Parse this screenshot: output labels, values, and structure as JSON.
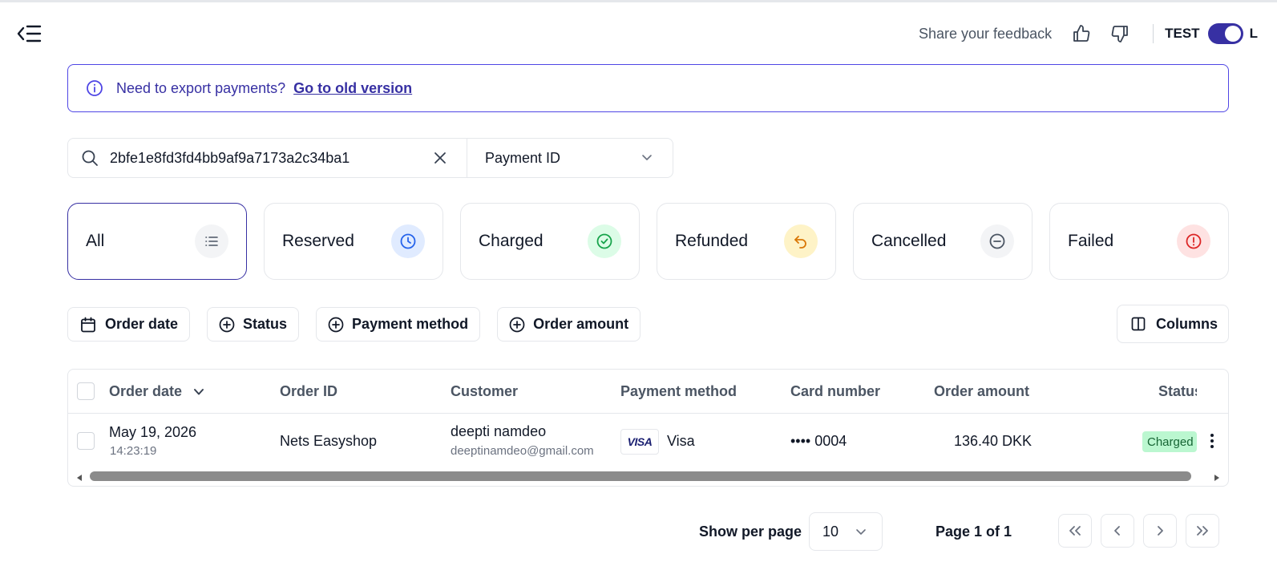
{
  "header": {
    "feedback_label": "Share your feedback",
    "mode_test_label": "TEST",
    "mode_live_label": "L"
  },
  "banner": {
    "text": "Need to export payments?",
    "link_label": "Go to old version"
  },
  "search": {
    "value": "2bfe1e8fd3fd4bb9af9a7173a2c34ba1",
    "type_selected": "Payment ID"
  },
  "status_cards": [
    {
      "label": "All",
      "icon": "list-icon",
      "active": true
    },
    {
      "label": "Reserved",
      "icon": "clock-icon"
    },
    {
      "label": "Charged",
      "icon": "check-circle-icon"
    },
    {
      "label": "Refunded",
      "icon": "undo-arrow-icon"
    },
    {
      "label": "Cancelled",
      "icon": "minus-circle-icon"
    },
    {
      "label": "Failed",
      "icon": "alert-circle-icon"
    }
  ],
  "filters": {
    "order_date": "Order date",
    "status": "Status",
    "payment_method": "Payment method",
    "order_amount": "Order amount",
    "columns": "Columns"
  },
  "table": {
    "headers": {
      "order_date": "Order date",
      "order_id": "Order ID",
      "customer": "Customer",
      "payment_method": "Payment method",
      "card_number": "Card number",
      "order_amount": "Order amount",
      "status": "Status"
    },
    "rows": [
      {
        "date": "May 19, 2026",
        "time": "14:23:19",
        "order_id": "Nets Easyshop",
        "customer_name": "deepti namdeo",
        "customer_email": "deeptinamdeo@gmail.com",
        "card_brand": "VISA",
        "payment_method": "Visa",
        "card_number": "•••• 0004",
        "amount": "136.40 DKK",
        "status": "Charged"
      }
    ]
  },
  "pagination": {
    "per_page_label": "Show per page",
    "per_page_value": "10",
    "page_info": "Page 1 of 1"
  },
  "colors": {
    "accent": "#3730a3",
    "charged_badge_bg": "#bbf7d0",
    "charged_badge_text": "#166534"
  }
}
